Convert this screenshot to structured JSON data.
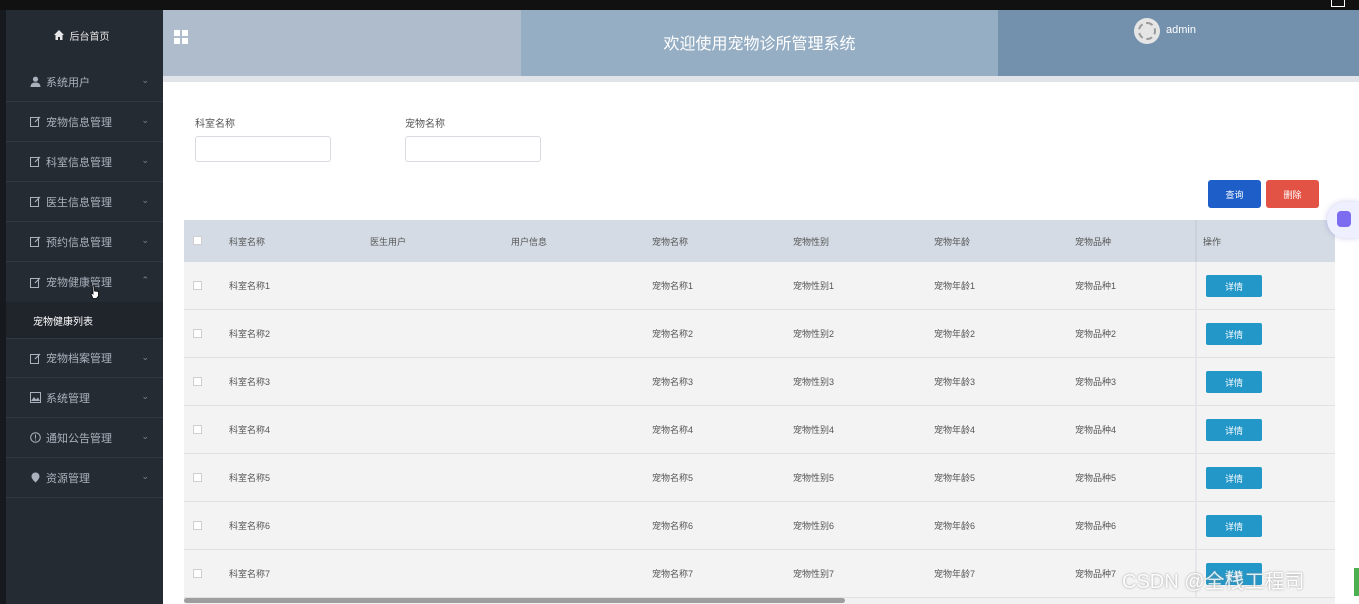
{
  "header": {
    "title": "欢迎使用宠物诊所管理系统",
    "username": "admin"
  },
  "sidebar": {
    "home_label": "后台首页",
    "items": [
      {
        "label": "系统用户",
        "icon": "user-icon"
      },
      {
        "label": "宠物信息管理",
        "icon": "edit-icon"
      },
      {
        "label": "科室信息管理",
        "icon": "edit-icon"
      },
      {
        "label": "医生信息管理",
        "icon": "edit-icon"
      },
      {
        "label": "预约信息管理",
        "icon": "edit-icon"
      },
      {
        "label": "宠物健康管理",
        "icon": "edit-icon",
        "expanded": true
      },
      {
        "label": "宠物档案管理",
        "icon": "edit-icon"
      },
      {
        "label": "系统管理",
        "icon": "image-icon"
      },
      {
        "label": "通知公告管理",
        "icon": "info-icon"
      },
      {
        "label": "资源管理",
        "icon": "location-icon"
      }
    ],
    "submenu": {
      "label": "宠物健康列表"
    }
  },
  "search": {
    "field1_label": "科室名称",
    "field1_value": "",
    "field2_label": "宠物名称",
    "field2_value": "",
    "query_label": "查询",
    "delete_label": "删除"
  },
  "table": {
    "columns": [
      "科室名称",
      "医生用户",
      "用户信息",
      "宠物名称",
      "宠物性别",
      "宠物年龄",
      "宠物品种",
      "操作"
    ],
    "detail_label": "详情",
    "rows": [
      {
        "dept": "科室名称1",
        "doctor": "",
        "userinfo": "",
        "pet": "宠物名称1",
        "gender": "宠物性别1",
        "age": "宠物年龄1",
        "breed": "宠物品种1"
      },
      {
        "dept": "科室名称2",
        "doctor": "",
        "userinfo": "",
        "pet": "宠物名称2",
        "gender": "宠物性别2",
        "age": "宠物年龄2",
        "breed": "宠物品种2"
      },
      {
        "dept": "科室名称3",
        "doctor": "",
        "userinfo": "",
        "pet": "宠物名称3",
        "gender": "宠物性别3",
        "age": "宠物年龄3",
        "breed": "宠物品种3"
      },
      {
        "dept": "科室名称4",
        "doctor": "",
        "userinfo": "",
        "pet": "宠物名称4",
        "gender": "宠物性别4",
        "age": "宠物年龄4",
        "breed": "宠物品种4"
      },
      {
        "dept": "科室名称5",
        "doctor": "",
        "userinfo": "",
        "pet": "宠物名称5",
        "gender": "宠物性别5",
        "age": "宠物年龄5",
        "breed": "宠物品种5"
      },
      {
        "dept": "科室名称6",
        "doctor": "",
        "userinfo": "",
        "pet": "宠物名称6",
        "gender": "宠物性别6",
        "age": "宠物年龄6",
        "breed": "宠物品种6"
      },
      {
        "dept": "科室名称7",
        "doctor": "",
        "userinfo": "",
        "pet": "宠物名称7",
        "gender": "宠物性别7",
        "age": "宠物年龄7",
        "breed": "宠物品种7"
      }
    ]
  },
  "watermark": "CSDN @全栈工程司",
  "colors": {
    "sidebar_bg": "#252b33",
    "header_bg": "#aebccb",
    "query_button": "#1e5ec8",
    "delete_button": "#e35345",
    "detail_button": "#2297c8",
    "table_header_bg": "#d4dbe4"
  }
}
